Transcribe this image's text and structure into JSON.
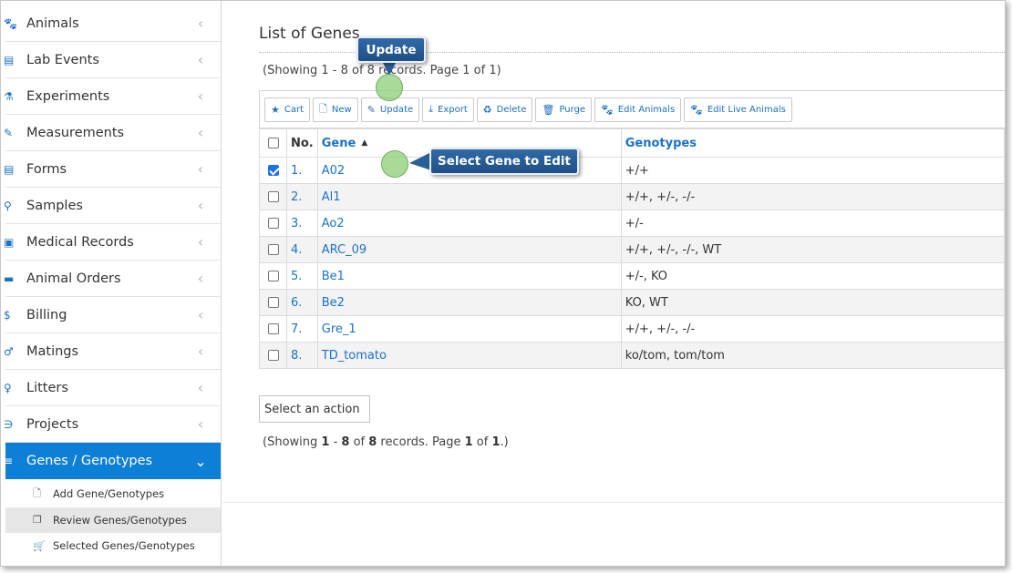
{
  "sidebar": {
    "items": [
      {
        "label": "Animals",
        "icon": "paw-icon",
        "glyph": "🐾"
      },
      {
        "label": "Lab Events",
        "icon": "clipboard-icon",
        "glyph": "▤"
      },
      {
        "label": "Experiments",
        "icon": "flask-icon",
        "glyph": "⚗"
      },
      {
        "label": "Measurements",
        "icon": "measure-icon",
        "glyph": "✎"
      },
      {
        "label": "Forms",
        "icon": "form-icon",
        "glyph": "▤"
      },
      {
        "label": "Samples",
        "icon": "sample-icon",
        "glyph": "⚲"
      },
      {
        "label": "Medical Records",
        "icon": "medical-icon",
        "glyph": "▣"
      },
      {
        "label": "Animal Orders",
        "icon": "cart-icon",
        "glyph": "▬"
      },
      {
        "label": "Billing",
        "icon": "dollar-icon",
        "glyph": "$"
      },
      {
        "label": "Matings",
        "icon": "mars-icon",
        "glyph": "♂"
      },
      {
        "label": "Litters",
        "icon": "venus-icon",
        "glyph": "♀"
      },
      {
        "label": "Projects",
        "icon": "project-icon",
        "glyph": "∋"
      }
    ],
    "active": {
      "label": "Genes / Genotypes",
      "icon": "list-icon",
      "glyph": "≡"
    },
    "subitems": [
      {
        "label": "Add Gene/Genotypes",
        "icon": "file-icon",
        "glyph": "🗋"
      },
      {
        "label": "Review Genes/Genotypes",
        "icon": "copy-icon",
        "glyph": "❐"
      },
      {
        "label": "Selected Genes/Genotypes",
        "icon": "cart-icon",
        "glyph": "🛒"
      }
    ]
  },
  "main": {
    "title": "List of Genes",
    "showing_top": "(Showing 1 - 8 of 8 records. Page 1 of 1)",
    "toolbar": [
      {
        "label": "Cart",
        "glyph": "★"
      },
      {
        "label": "New",
        "glyph": "🗋"
      },
      {
        "label": "Update",
        "glyph": "✎"
      },
      {
        "label": "Export",
        "glyph": "⤓"
      },
      {
        "label": "Delete",
        "glyph": "♻"
      },
      {
        "label": "Purge",
        "glyph": "🗑"
      },
      {
        "label": "Edit Animals",
        "glyph": "🐾"
      },
      {
        "label": "Edit Live Animals",
        "glyph": "🐾"
      }
    ],
    "table": {
      "headers": {
        "no": "No.",
        "gene": "Gene",
        "genotypes": "Genotypes"
      },
      "rows": [
        {
          "no": "1.",
          "gene": "A02",
          "genotypes": "+/+",
          "checked": true
        },
        {
          "no": "2.",
          "gene": "Al1",
          "genotypes": "+/+, +/-, -/-",
          "checked": false
        },
        {
          "no": "3.",
          "gene": "Ao2",
          "genotypes": "+/-",
          "checked": false
        },
        {
          "no": "4.",
          "gene": "ARC_09",
          "genotypes": "+/+, +/-, -/-, WT",
          "checked": false
        },
        {
          "no": "5.",
          "gene": "Be1",
          "genotypes": "+/-, KO",
          "checked": false
        },
        {
          "no": "6.",
          "gene": "Be2",
          "genotypes": "KO, WT",
          "checked": false
        },
        {
          "no": "7.",
          "gene": "Gre_1",
          "genotypes": "+/+, +/-, -/-",
          "checked": false
        },
        {
          "no": "8.",
          "gene": "TD_tomato",
          "genotypes": "ko/tom, tom/tom",
          "checked": false
        }
      ]
    },
    "action_select": "Select an action",
    "showing_bottom": {
      "a": "(Showing ",
      "b": "1",
      "c": " - ",
      "d": "8",
      "e": " of ",
      "f": "8",
      "g": " records. Page ",
      "h": "1",
      "i": " of ",
      "j": "1",
      "k": ".)"
    }
  },
  "callouts": {
    "update": "Update",
    "select_gene": "Select Gene to Edit"
  },
  "colors": {
    "accent": "#0d7fd6",
    "link": "#1a73c8",
    "callout": "#2a5f9a"
  }
}
